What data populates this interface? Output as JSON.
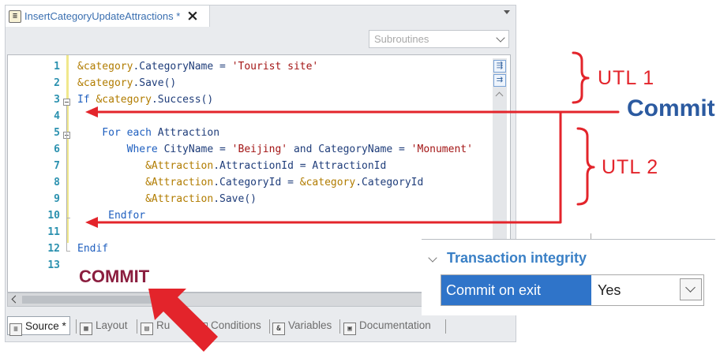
{
  "window": {
    "tab_title": "InsertCategoryUpdateAttractions *",
    "close_glyph": "×",
    "subroutines_placeholder": "Subroutines"
  },
  "editor": {
    "lines": [
      {
        "n": "1",
        "segs": [
          {
            "t": "&category",
            "c": "var"
          },
          {
            "t": ".CategoryName = ",
            "c": "txt"
          },
          {
            "t": "'Tourist site'",
            "c": "str"
          }
        ]
      },
      {
        "n": "2",
        "segs": [
          {
            "t": "&category",
            "c": "var"
          },
          {
            "t": ".Save()",
            "c": "txt"
          }
        ]
      },
      {
        "n": "3",
        "segs": [
          {
            "t": "If ",
            "c": "kw"
          },
          {
            "t": "&category",
            "c": "var"
          },
          {
            "t": ".Success()",
            "c": "txt"
          }
        ]
      },
      {
        "n": "4",
        "segs": []
      },
      {
        "n": "5",
        "segs": [
          {
            "t": "    For each ",
            "c": "kw"
          },
          {
            "t": "Attraction",
            "c": "txt"
          }
        ]
      },
      {
        "n": "6",
        "segs": [
          {
            "t": "        Where ",
            "c": "kw"
          },
          {
            "t": "CityName = ",
            "c": "txt"
          },
          {
            "t": "'Beijing'",
            "c": "str"
          },
          {
            "t": " and CategoryName = ",
            "c": "txt"
          },
          {
            "t": "'Monument'",
            "c": "str"
          }
        ]
      },
      {
        "n": "7",
        "segs": [
          {
            "t": "           &Attraction",
            "c": "var"
          },
          {
            "t": ".AttractionId = AttractionId",
            "c": "txt"
          }
        ]
      },
      {
        "n": "8",
        "segs": [
          {
            "t": "           &Attraction",
            "c": "var"
          },
          {
            "t": ".CategoryId = ",
            "c": "txt"
          },
          {
            "t": "&category",
            "c": "var"
          },
          {
            "t": ".CategoryId",
            "c": "txt"
          }
        ]
      },
      {
        "n": "9",
        "segs": [
          {
            "t": "           &Attraction",
            "c": "var"
          },
          {
            "t": ".Save()",
            "c": "txt"
          }
        ]
      },
      {
        "n": "10",
        "segs": [
          {
            "t": "     Endfor",
            "c": "kw"
          }
        ]
      },
      {
        "n": "11",
        "segs": []
      },
      {
        "n": "12",
        "segs": [
          {
            "t": "Endif",
            "c": "kw"
          }
        ]
      },
      {
        "n": "13",
        "segs": []
      }
    ],
    "commit_word": "COMMIT"
  },
  "bottom_tabs": [
    {
      "label": "Source *",
      "icon": "source-icon"
    },
    {
      "label": "Layout",
      "icon": "layout-icon"
    },
    {
      "label": "Ru",
      "icon": "rules-icon"
    },
    {
      "label": "Conditions",
      "icon": "conditions-icon"
    },
    {
      "label": "Variables",
      "icon": "variables-icon"
    },
    {
      "label": "Documentation",
      "icon": "documentation-icon"
    }
  ],
  "annotations": {
    "utl1": "UTL 1",
    "utl2": "UTL 2",
    "commit": "Commit"
  },
  "properties": {
    "group_title": "Transaction integrity",
    "row_name": "Commit on exit",
    "row_value": "Yes"
  },
  "colors": {
    "annotation_red": "#e3242b",
    "commit_blue": "#2b5aa0",
    "selection_blue": "#2f74c9",
    "keyword_blue": "#1f5fbf",
    "variable_gold": "#b17c00",
    "string_red": "#a31515"
  }
}
